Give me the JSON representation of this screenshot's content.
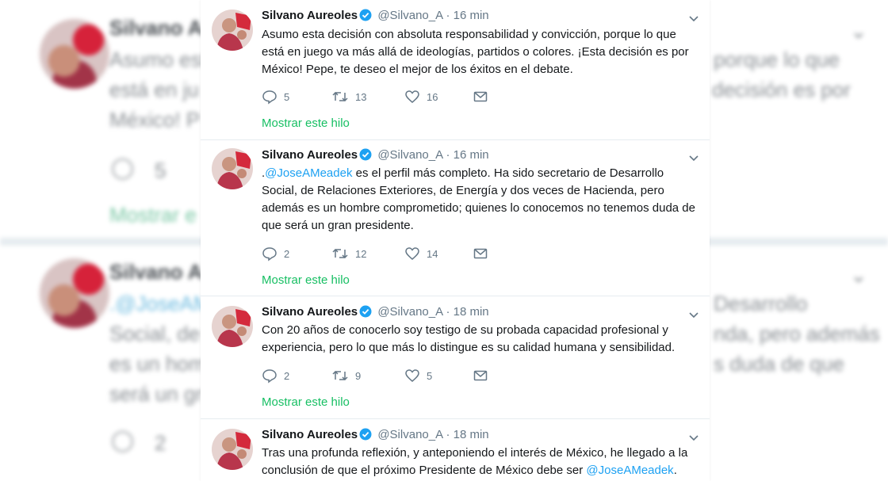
{
  "colors": {
    "link": "#1da1f2",
    "thread": "#17bf63",
    "secondary": "#657786",
    "text": "#14171a",
    "separator": "#e6ecf0"
  },
  "icons": {
    "reply": "reply-icon",
    "retweet": "retweet-icon",
    "like": "heart-icon",
    "dm": "envelope-icon",
    "verified": "verified-badge-icon",
    "menu": "chevron-down-icon"
  },
  "background": {
    "rows": [
      {
        "name": "Silvano A",
        "line1": "Asumo est",
        "line1_right": "porque lo que",
        "line2": "está en ju",
        "line2_right": "decisión es por",
        "line3": "México! P",
        "reply_count": "5",
        "thread": "Mostrar e"
      },
      {
        "name": "Silvano A",
        "line1": ".@JoseAM",
        "line1_right": "Desarrollo",
        "line2": "Social, de",
        "line2_right": "nda, pero además",
        "line3": "es un hom",
        "line3_right": "s duda de que",
        "line4": "será un gr",
        "reply_count": "2"
      }
    ]
  },
  "tweets": [
    {
      "name": "Silvano Aureoles",
      "handle": "@Silvano_A",
      "dot": "·",
      "time": "16 min",
      "text_parts": {
        "pre": "Asumo esta decisión con absoluta responsabilidad y convicción, porque lo que está en juego va más allá de ideologías, partidos o colores. ¡Esta decisión es por México! Pepe, te deseo el mejor de los éxitos en el debate.",
        "mention": "",
        "post": ""
      },
      "replies": "5",
      "retweets": "13",
      "likes": "16",
      "thread": "Mostrar este hilo"
    },
    {
      "name": "Silvano Aureoles",
      "handle": "@Silvano_A",
      "dot": "·",
      "time": "16 min",
      "text_parts": {
        "pre": ".",
        "mention": "@JoseAMeadek",
        "post": " es el perfil más completo. Ha sido secretario de Desarrollo Social, de Relaciones Exteriores, de Energía y dos veces de Hacienda, pero además es un hombre comprometido; quienes lo conocemos no tenemos duda de que será un gran presidente."
      },
      "replies": "2",
      "retweets": "12",
      "likes": "14",
      "thread": "Mostrar este hilo"
    },
    {
      "name": "Silvano Aureoles",
      "handle": "@Silvano_A",
      "dot": "·",
      "time": "18 min",
      "text_parts": {
        "pre": "Con 20 años de conocerlo soy testigo de su probada capacidad profesional y experiencia, pero lo que más lo distingue es su calidad humana y sensibilidad.",
        "mention": "",
        "post": ""
      },
      "replies": "2",
      "retweets": "9",
      "likes": "5",
      "thread": "Mostrar este hilo"
    },
    {
      "name": "Silvano Aureoles",
      "handle": "@Silvano_A",
      "dot": "·",
      "time": "18 min",
      "text_parts": {
        "pre": "Tras una profunda reflexión, y anteponiendo el interés de México, he llegado a la conclusión de que el próximo Presidente de México debe ser ",
        "mention": "@JoseAMeadek",
        "post": "."
      }
    }
  ]
}
